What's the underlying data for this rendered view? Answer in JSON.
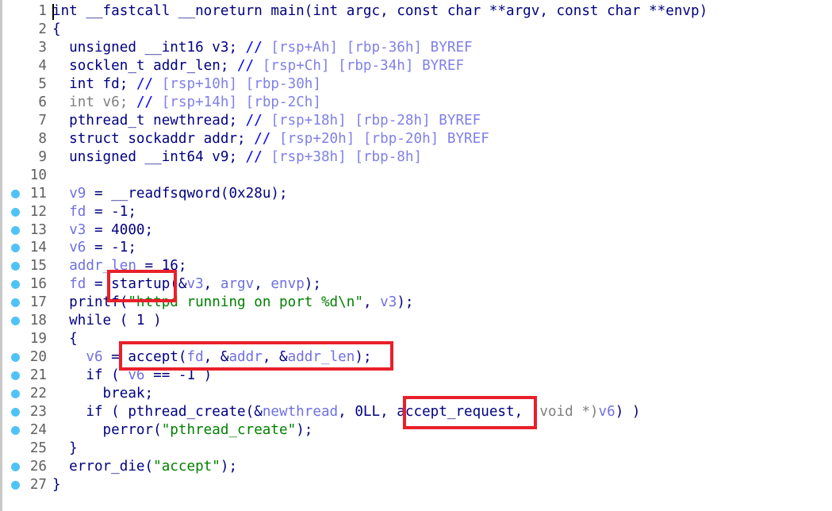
{
  "lines": [
    {
      "n": "1",
      "dot": false,
      "t": [
        [
          "int __fastcall __noreturn main(int argc, const char **argv, const char **envp)",
          "k"
        ]
      ]
    },
    {
      "n": "2",
      "dot": false,
      "t": [
        [
          "{",
          "k"
        ]
      ]
    },
    {
      "n": "3",
      "dot": false,
      "t": [
        [
          "  unsigned __int16 v3; ",
          "k"
        ],
        [
          "// ",
          "c"
        ],
        [
          "[rsp+Ah] [rbp-36h] BYREF",
          "cm"
        ]
      ]
    },
    {
      "n": "4",
      "dot": false,
      "t": [
        [
          "  socklen_t addr_len; ",
          "k"
        ],
        [
          "// ",
          "c"
        ],
        [
          "[rsp+Ch] [rbp-34h] BYREF",
          "cm"
        ]
      ]
    },
    {
      "n": "5",
      "dot": false,
      "t": [
        [
          "  int fd; ",
          "k"
        ],
        [
          "// ",
          "c"
        ],
        [
          "[rsp+10h] [rbp-30h]",
          "cm"
        ]
      ]
    },
    {
      "n": "6",
      "dot": false,
      "t": [
        [
          "  int v6; ",
          "g"
        ],
        [
          "// ",
          "c"
        ],
        [
          "[rsp+14h] [rbp-2Ch]",
          "cm"
        ]
      ]
    },
    {
      "n": "7",
      "dot": false,
      "t": [
        [
          "  pthread_t newthread; ",
          "k"
        ],
        [
          "// ",
          "c"
        ],
        [
          "[rsp+18h] [rbp-28h] BYREF",
          "cm"
        ]
      ]
    },
    {
      "n": "8",
      "dot": false,
      "t": [
        [
          "  struct sockaddr addr; ",
          "k"
        ],
        [
          "// ",
          "c"
        ],
        [
          "[rsp+20h] [rbp-20h] BYREF",
          "cm"
        ]
      ]
    },
    {
      "n": "9",
      "dot": false,
      "t": [
        [
          "  unsigned __int64 v9; ",
          "k"
        ],
        [
          "// ",
          "c"
        ],
        [
          "[rsp+38h] [rbp-8h]",
          "cm"
        ]
      ]
    },
    {
      "n": "10",
      "dot": false,
      "t": []
    },
    {
      "n": "11",
      "dot": true,
      "t": [
        [
          "  ",
          "k"
        ],
        [
          "v9",
          "v"
        ],
        [
          " = __readfsqword(0x28u);",
          "k"
        ]
      ]
    },
    {
      "n": "12",
      "dot": true,
      "t": [
        [
          "  ",
          "k"
        ],
        [
          "fd",
          "v"
        ],
        [
          " = -1;",
          "k"
        ]
      ]
    },
    {
      "n": "13",
      "dot": true,
      "t": [
        [
          "  ",
          "k"
        ],
        [
          "v3",
          "v"
        ],
        [
          " = 4000;",
          "k"
        ]
      ]
    },
    {
      "n": "14",
      "dot": true,
      "t": [
        [
          "  ",
          "k"
        ],
        [
          "v6",
          "v"
        ],
        [
          " = -1;",
          "k"
        ]
      ]
    },
    {
      "n": "15",
      "dot": true,
      "t": [
        [
          "  ",
          "k"
        ],
        [
          "addr_len",
          "v"
        ],
        [
          " = 16;",
          "k"
        ]
      ]
    },
    {
      "n": "16",
      "dot": true,
      "t": [
        [
          "  ",
          "k"
        ],
        [
          "fd",
          "v"
        ],
        [
          " = startup(&",
          "k"
        ],
        [
          "v3",
          "v"
        ],
        [
          ", ",
          "k"
        ],
        [
          "argv",
          "v"
        ],
        [
          ", ",
          "k"
        ],
        [
          "envp",
          "v"
        ],
        [
          ");",
          "k"
        ]
      ]
    },
    {
      "n": "17",
      "dot": true,
      "t": [
        [
          "  printf(",
          "k"
        ],
        [
          "\"httpd running on port %d\\n\"",
          "s"
        ],
        [
          ", ",
          "k"
        ],
        [
          "v3",
          "v"
        ],
        [
          ");",
          "k"
        ]
      ]
    },
    {
      "n": "18",
      "dot": true,
      "t": [
        [
          "  while ( 1 )",
          "k"
        ]
      ]
    },
    {
      "n": "19",
      "dot": false,
      "t": [
        [
          "  {",
          "k"
        ]
      ]
    },
    {
      "n": "20",
      "dot": true,
      "t": [
        [
          "    ",
          "k"
        ],
        [
          "v6",
          "v"
        ],
        [
          " = accept(",
          "k"
        ],
        [
          "fd",
          "v"
        ],
        [
          ", &",
          "k"
        ],
        [
          "addr",
          "v"
        ],
        [
          ", &",
          "k"
        ],
        [
          "addr_len",
          "v"
        ],
        [
          ");",
          "k"
        ]
      ]
    },
    {
      "n": "21",
      "dot": true,
      "t": [
        [
          "    if ( ",
          "k"
        ],
        [
          "v6",
          "v"
        ],
        [
          " == -1 )",
          "k"
        ]
      ]
    },
    {
      "n": "22",
      "dot": true,
      "t": [
        [
          "      break;",
          "k"
        ]
      ]
    },
    {
      "n": "23",
      "dot": true,
      "t": [
        [
          "    if ( pthread_create(&",
          "k"
        ],
        [
          "newthread",
          "v"
        ],
        [
          ", 0LL, accept_request, ",
          "k"
        ],
        [
          "(void *)",
          "g"
        ],
        [
          "v6",
          "v"
        ],
        [
          ") )",
          "k"
        ]
      ]
    },
    {
      "n": "24",
      "dot": true,
      "t": [
        [
          "      perror(",
          "k"
        ],
        [
          "\"pthread_create\"",
          "s"
        ],
        [
          ");",
          "k"
        ]
      ]
    },
    {
      "n": "25",
      "dot": false,
      "t": [
        [
          "  }",
          "k"
        ]
      ]
    },
    {
      "n": "26",
      "dot": true,
      "t": [
        [
          "  error_die(",
          "k"
        ],
        [
          "\"accept\"",
          "s"
        ],
        [
          ");",
          "k"
        ]
      ]
    },
    {
      "n": "27",
      "dot": true,
      "t": [
        [
          "}",
          "k"
        ]
      ]
    }
  ],
  "highlight_color": "#e8202a",
  "breakpoint_dot_color": "#4fc3f7"
}
